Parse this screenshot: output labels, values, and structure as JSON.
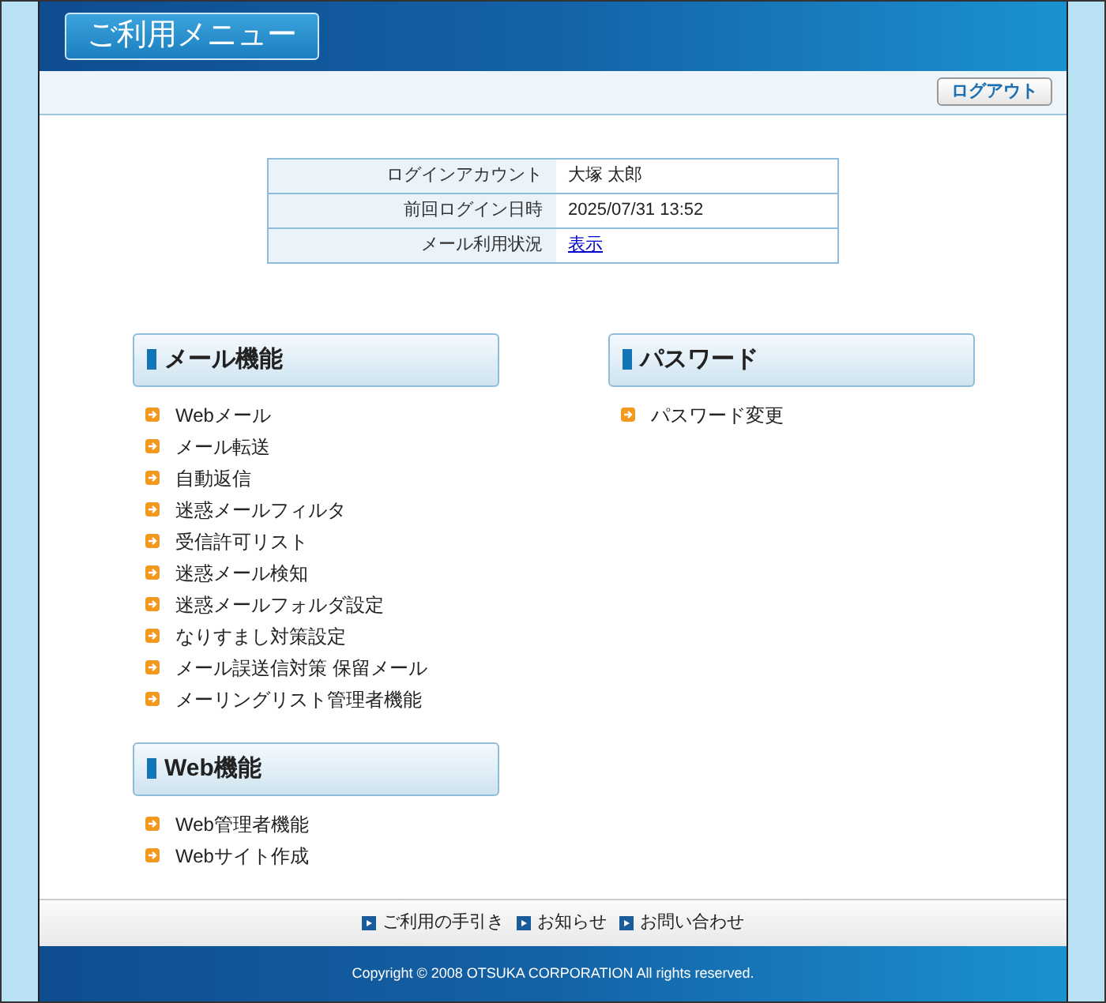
{
  "header": {
    "title": "ご利用メニュー"
  },
  "toolbar": {
    "logout": "ログアウト"
  },
  "account_table": {
    "rows": [
      {
        "label": "ログインアカウント",
        "value": "大塚 太郎",
        "kind": "text"
      },
      {
        "label": "前回ログイン日時",
        "value": "2025/07/31 13:52",
        "kind": "text"
      },
      {
        "label": "メール利用状況",
        "value": "表示",
        "kind": "link"
      }
    ]
  },
  "columns": [
    {
      "sections": [
        {
          "title": "メール機能",
          "items": [
            "Webメール",
            "メール転送",
            "自動返信",
            "迷惑メールフィルタ",
            "受信許可リスト",
            "迷惑メール検知",
            "迷惑メールフォルダ設定",
            "なりすまし対策設定",
            "メール誤送信対策 保留メール",
            "メーリングリスト管理者機能"
          ]
        },
        {
          "title": "Web機能",
          "items": [
            "Web管理者機能",
            "Webサイト作成"
          ]
        }
      ]
    },
    {
      "sections": [
        {
          "title": "パスワード",
          "items": [
            "パスワード変更"
          ]
        }
      ]
    }
  ],
  "footer": {
    "links": [
      "ご利用の手引き",
      "お知らせ",
      "お問い合わせ"
    ],
    "copyright": "Copyright © 2008 OTSUKA CORPORATION All rights reserved."
  }
}
